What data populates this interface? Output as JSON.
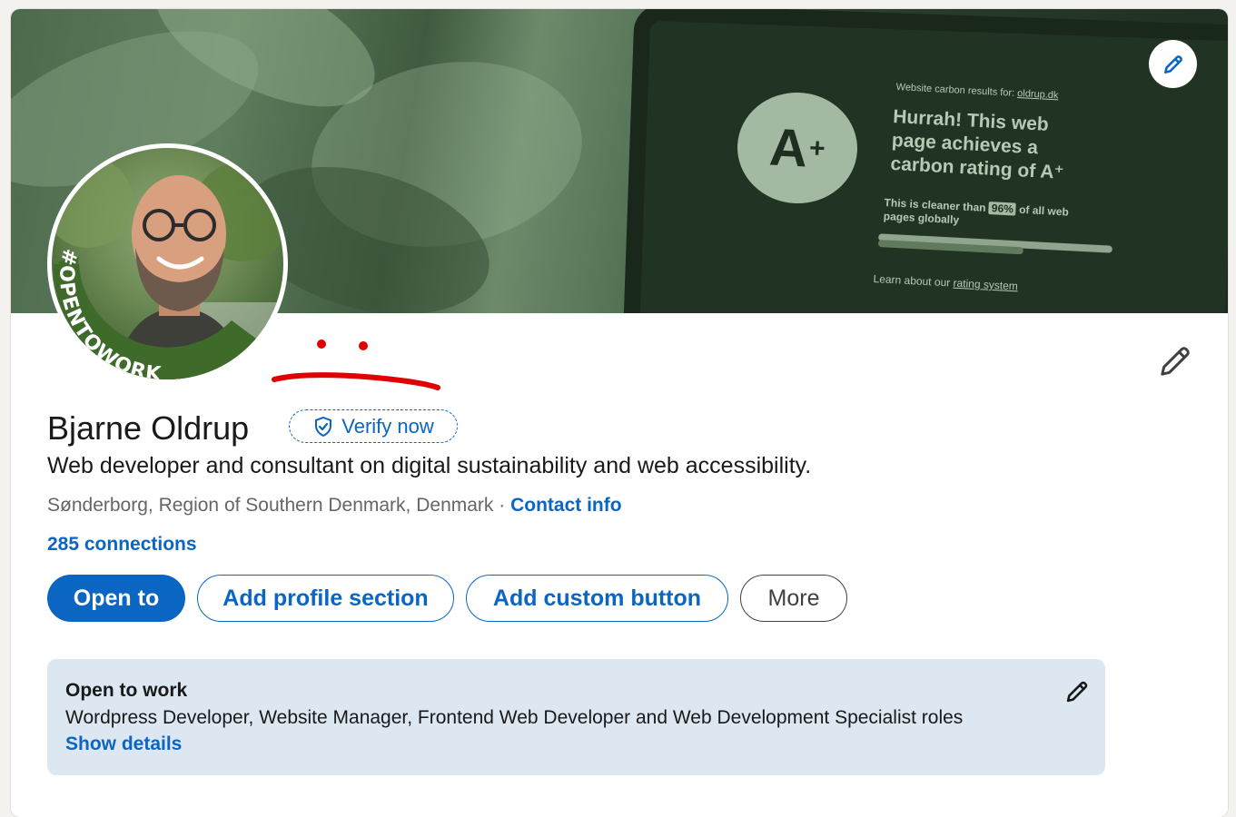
{
  "banner": {
    "site_label": "Website carbon results for:",
    "site_link": "oldrup.dk",
    "rating": "A",
    "rating_plus": "+",
    "headline_line1": "Hurrah! This web",
    "headline_line2": "page achieves a",
    "headline_line3": "carbon rating of A⁺",
    "cleaner_prefix": "This is cleaner than",
    "cleaner_percent": "96%",
    "cleaner_suffix": "of all web",
    "cleaner_line2": "pages globally",
    "learn_prefix": "Learn about our",
    "learn_link": "rating system",
    "edit_icon": "pencil-icon"
  },
  "avatar": {
    "frame_text": "#OPENTOWORK",
    "frame_color": "#3f6b2a"
  },
  "profile": {
    "name": "Bjarne Oldrup",
    "verify_label": "Verify now",
    "headline": "Web developer and consultant on digital sustainability and web accessibility.",
    "location": "Sønderborg, Region of Southern Denmark, Denmark",
    "separator": " · ",
    "contact_link": "Contact info",
    "connections": "285 connections"
  },
  "actions": {
    "open_to": "Open to",
    "add_section": "Add profile section",
    "add_custom": "Add custom button",
    "more": "More"
  },
  "open_to_work": {
    "title": "Open to work",
    "roles": "Wordpress Developer, Website Manager, Frontend Web Developer and Web Development Specialist roles",
    "show_details": "Show details"
  },
  "colors": {
    "accent": "#0a66c2",
    "card_bg": "#ffffff",
    "page_bg": "#f4f2ee",
    "otw_bg": "#dde7f1",
    "annotation_red": "#e00000"
  }
}
